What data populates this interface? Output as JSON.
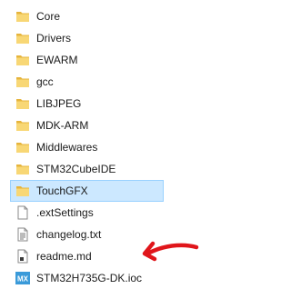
{
  "files": [
    {
      "name": "Core",
      "type": "folder",
      "icon": "folder-icon",
      "selected": false
    },
    {
      "name": "Drivers",
      "type": "folder",
      "icon": "folder-icon",
      "selected": false
    },
    {
      "name": "EWARM",
      "type": "folder",
      "icon": "folder-icon",
      "selected": false
    },
    {
      "name": "gcc",
      "type": "folder",
      "icon": "folder-icon",
      "selected": false
    },
    {
      "name": "LIBJPEG",
      "type": "folder",
      "icon": "folder-icon",
      "selected": false
    },
    {
      "name": "MDK-ARM",
      "type": "folder",
      "icon": "folder-icon",
      "selected": false
    },
    {
      "name": "Middlewares",
      "type": "folder",
      "icon": "folder-icon",
      "selected": false
    },
    {
      "name": "STM32CubeIDE",
      "type": "folder",
      "icon": "folder-icon",
      "selected": false
    },
    {
      "name": "TouchGFX",
      "type": "folder",
      "icon": "folder-icon",
      "selected": true
    },
    {
      "name": ".extSettings",
      "type": "file",
      "icon": "blank-file-icon",
      "selected": false
    },
    {
      "name": "changelog.txt",
      "type": "file",
      "icon": "text-file-icon",
      "selected": false
    },
    {
      "name": "readme.md",
      "type": "file",
      "icon": "markdown-file-icon",
      "selected": false
    },
    {
      "name": "STM32H735G-DK.ioc",
      "type": "file",
      "icon": "stm32cubemx-icon",
      "icon_text": "MX",
      "selected": false
    }
  ],
  "colors": {
    "folder": "#f8d775",
    "folder_dark": "#e6b43c",
    "selection_bg": "#cce8ff",
    "selection_border": "#99d1ff",
    "mx_icon": "#3a9ad9",
    "arrow": "#e0161b"
  }
}
